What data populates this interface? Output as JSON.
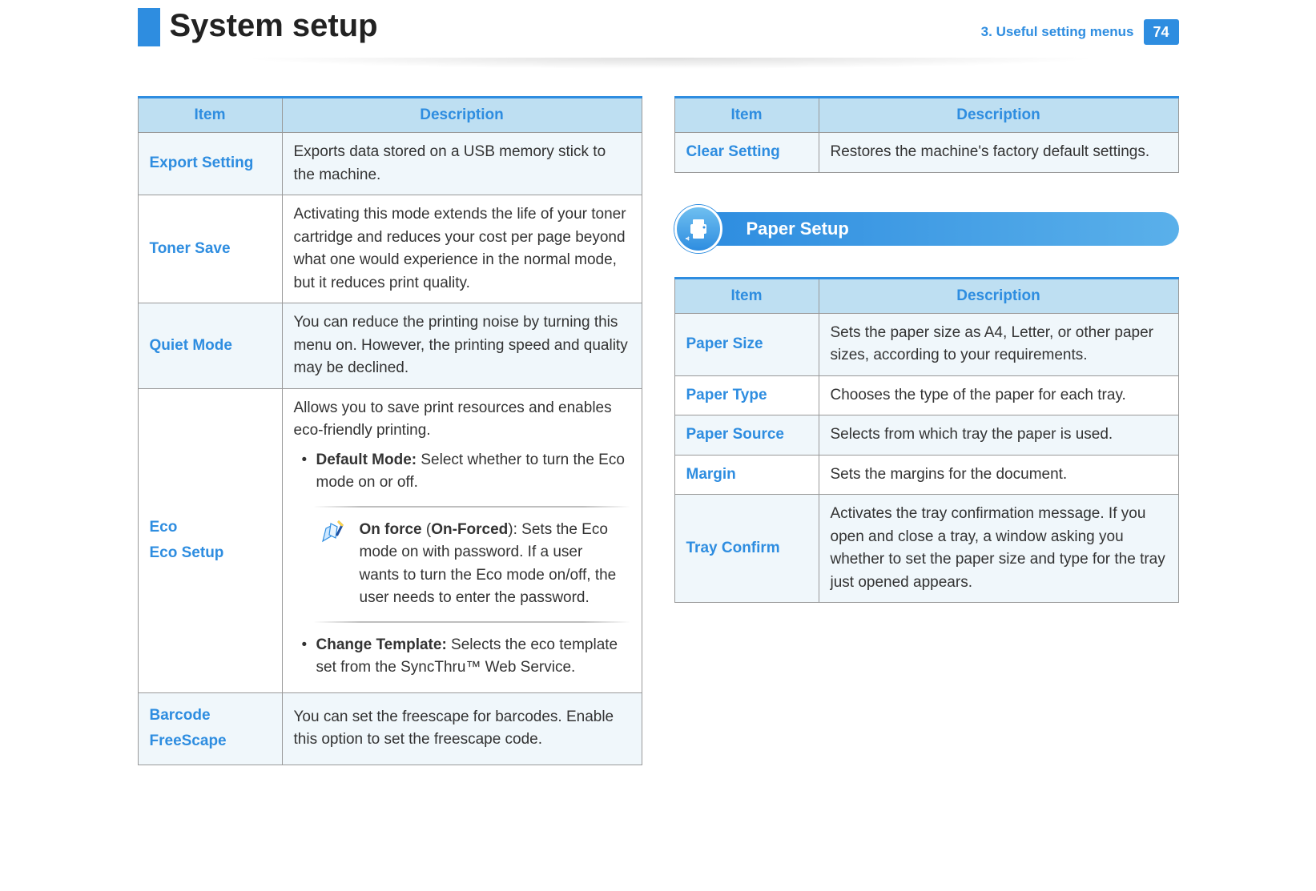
{
  "header": {
    "title": "System setup",
    "chapter": "3.  Useful setting menus",
    "page": "74"
  },
  "table_headers": {
    "item": "Item",
    "description": "Description"
  },
  "left_table": {
    "rows": [
      {
        "item": "Export Setting",
        "desc": "Exports data stored on a USB memory stick to the machine."
      },
      {
        "item": "Toner Save",
        "desc": "Activating this mode extends the life of your toner cartridge and reduces your cost per page beyond what one would experience in the normal mode, but it reduces print quality."
      },
      {
        "item": "Quiet Mode",
        "desc": "You can reduce the printing noise by turning this menu on. However, the printing speed and quality may be declined."
      }
    ],
    "eco": {
      "label1": "Eco",
      "label2": "Eco Setup",
      "intro": "Allows you to save print resources and enables eco-friendly printing.",
      "bullet1_bold": "Default Mode:",
      "bullet1_rest": " Select whether to turn the Eco mode on or off.",
      "note_bold1": "On force",
      "note_paren_open": " (",
      "note_bold2": "On-Forced",
      "note_rest": "): Sets the Eco mode on with password. If a user wants to turn the Eco mode on/off, the user needs to enter the password.",
      "bullet2_bold": "Change Template:",
      "bullet2_rest": " Selects the eco template set from the SyncThru™ Web Service."
    },
    "barcode": {
      "label1": "Barcode",
      "label2": "FreeScape",
      "desc": "You can set the freescape for barcodes. Enable this option to set the freescape code."
    }
  },
  "right_table1": {
    "rows": [
      {
        "item": "Clear Setting",
        "desc": "Restores the machine's factory default settings."
      }
    ]
  },
  "section_paper": "Paper Setup",
  "right_table2": {
    "rows": [
      {
        "item": "Paper Size",
        "desc": "Sets the paper size as A4, Letter, or other paper sizes, according to your requirements."
      },
      {
        "item": "Paper Type",
        "desc": "Chooses the type of the paper for each tray."
      },
      {
        "item": "Paper Source",
        "desc": "Selects from which tray the paper is used."
      },
      {
        "item": "Margin",
        "desc": "Sets the margins for the document."
      },
      {
        "item": "Tray Confirm",
        "desc": "Activates the tray confirmation message. If you open and close a tray, a window asking you whether to set the paper size and type for the tray just opened appears."
      }
    ]
  }
}
